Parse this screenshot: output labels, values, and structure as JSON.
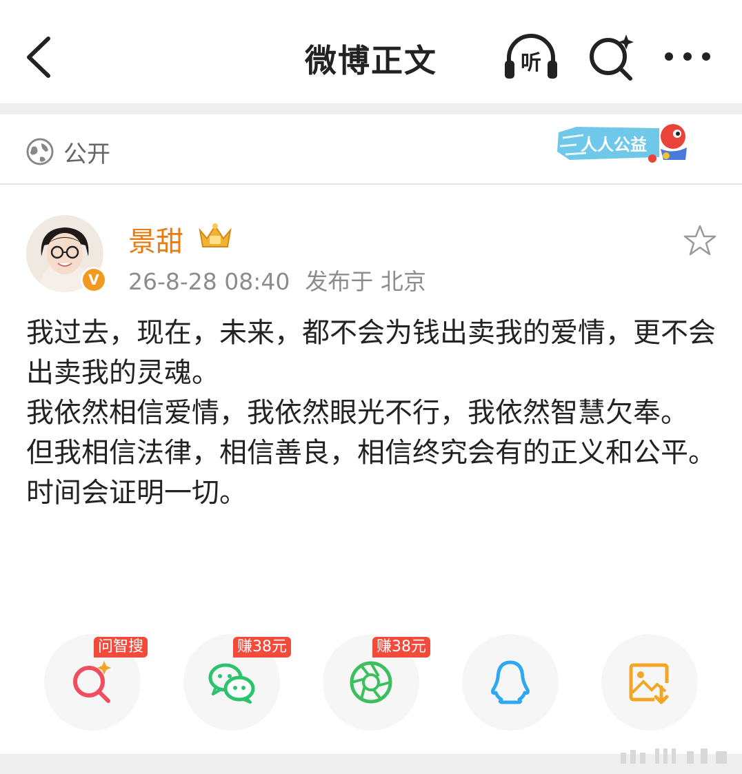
{
  "nav": {
    "title": "微博正文",
    "listen_label": "听"
  },
  "visibility": {
    "label": "公开",
    "badge_text": "人人公益"
  },
  "post": {
    "author": "景甜",
    "time": "26-8-28 08:40",
    "location": "发布于 北京",
    "verified_mark": "V",
    "paragraphs": [
      "我过去，现在，未来，都不会为钱出卖我的爱情，更不会出卖我的灵魂。",
      "我依然相信爱情，我依然眼光不行，我依然智慧欠奉。",
      "但我相信法律，相信善良，相信终究会有的正义和公平。",
      "时间会证明一切。"
    ]
  },
  "share": [
    {
      "icon": "ai-search-icon",
      "tag": "问智搜",
      "color": "#f04e5e"
    },
    {
      "icon": "wechat-icon",
      "tag": "赚38元",
      "color": "#2dc36e"
    },
    {
      "icon": "moments-icon",
      "tag": "赚38元",
      "color": "#3cbf5d"
    },
    {
      "icon": "qq-icon",
      "tag": "",
      "color": "#2ea8f0"
    },
    {
      "icon": "save-image-icon",
      "tag": "",
      "color": "#f3a624"
    }
  ],
  "colors": {
    "accent": "#e97b11",
    "tag_red": "#f24b3c",
    "meta_gray": "#8c8c8c",
    "divider": "#efefef"
  }
}
